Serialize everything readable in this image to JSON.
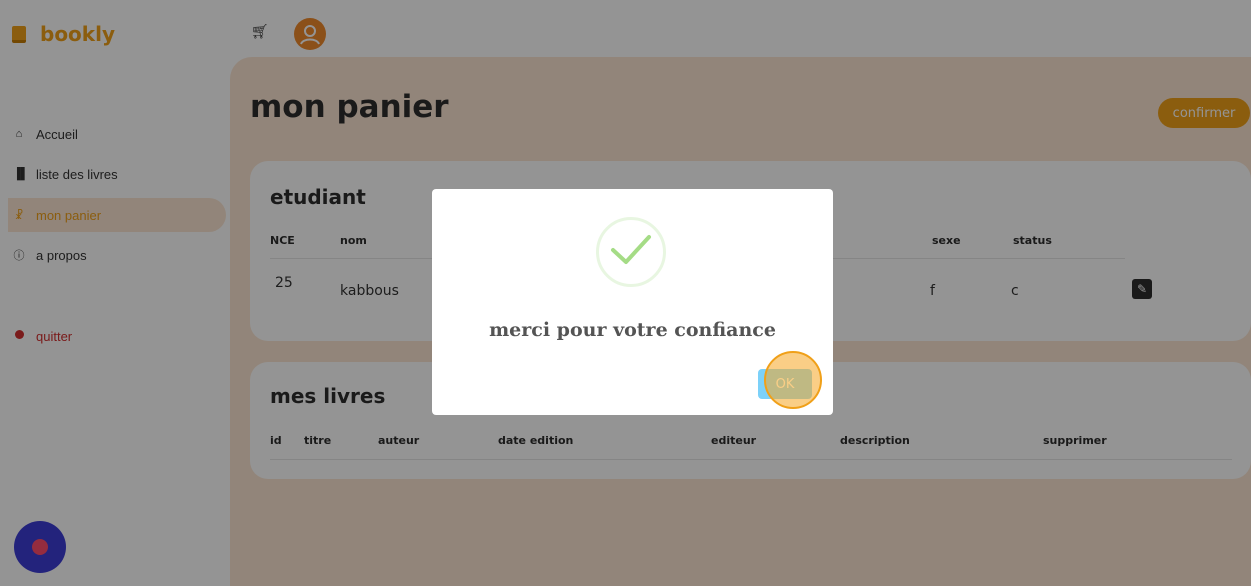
{
  "app": {
    "name": "bookly",
    "colors": {
      "accent": "#f0a019",
      "main_bg": "#fbe6d3",
      "danger": "#d32f2f",
      "ok_button": "#7cd1f9",
      "success": "#a5dc86"
    }
  },
  "topbar": {
    "icons": [
      "cart-icon",
      "user-avatar-icon"
    ]
  },
  "sidebar": {
    "items": [
      {
        "label": "Accueil",
        "icon": "home-icon",
        "active": false
      },
      {
        "label": "liste des livres",
        "icon": "chart-bars-icon",
        "active": false
      },
      {
        "label": "mon panier",
        "icon": "cart-icon",
        "active": true
      },
      {
        "label": "a propos",
        "icon": "info-icon",
        "active": false
      },
      {
        "label": "quitter",
        "icon": "exit-icon",
        "active": false
      }
    ]
  },
  "main": {
    "title": "mon panier",
    "confirm_label": "confirmer",
    "student": {
      "title": "etudiant",
      "headers": {
        "nce": "NCE",
        "nom": "nom",
        "sexe": "sexe",
        "status": "status"
      },
      "row": {
        "nce": "25",
        "nom": "kabbous",
        "sexe": "f",
        "status": "c"
      }
    },
    "books": {
      "title": "mes livres",
      "headers": {
        "id": "id",
        "titre": "titre",
        "auteur": "auteur",
        "date_edition": "date edition",
        "editeur": "editeur",
        "description": "description",
        "supprimer": "supprimer"
      }
    }
  },
  "modal": {
    "message": "merci pour votre confiance",
    "ok_label": "OK",
    "icon": "success-check-icon"
  }
}
